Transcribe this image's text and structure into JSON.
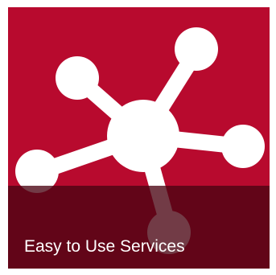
{
  "tile": {
    "label": "Easy to Use Services",
    "icon": "network-hub-icon"
  },
  "colors": {
    "tile_background": "#b80a2e",
    "caption_band": "#4a0412",
    "caption_band_opacity": "0.78",
    "icon_fill": "#ffffff",
    "caption_text": "#ffffff"
  }
}
